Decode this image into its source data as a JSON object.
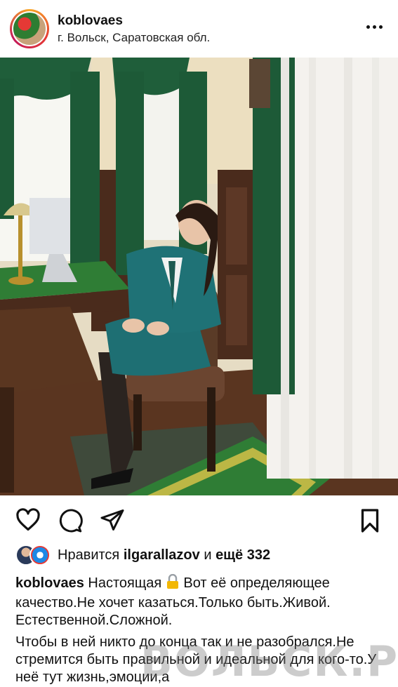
{
  "post": {
    "username": "koblovaes",
    "location": "г. Вольск, Саратовская обл."
  },
  "icons": {
    "more": "more-horizontal-icon",
    "like": "heart-icon",
    "comment": "comment-icon",
    "share": "paper-plane-icon",
    "save": "bookmark-icon",
    "lock": "lock-icon"
  },
  "likes": {
    "prefix": "Нравится",
    "user": "ilgarallazov",
    "middle": "и",
    "count_text": "ещё 332"
  },
  "caption": {
    "user": "koblovaes",
    "text_before_icon": "Настоящая",
    "text_after_icon": "Вот её определяющее качество.Не хочет казаться.Только быть.Живой. Естественной.Сложной.",
    "paragraph2": "Чтобы в ней никто до конца так и не разобрался.Не стремится быть правильной и идеальной для кого-то.У неё тут жизнь,эмоции,а"
  },
  "watermark": "ВОЛЬСК.РУ"
}
